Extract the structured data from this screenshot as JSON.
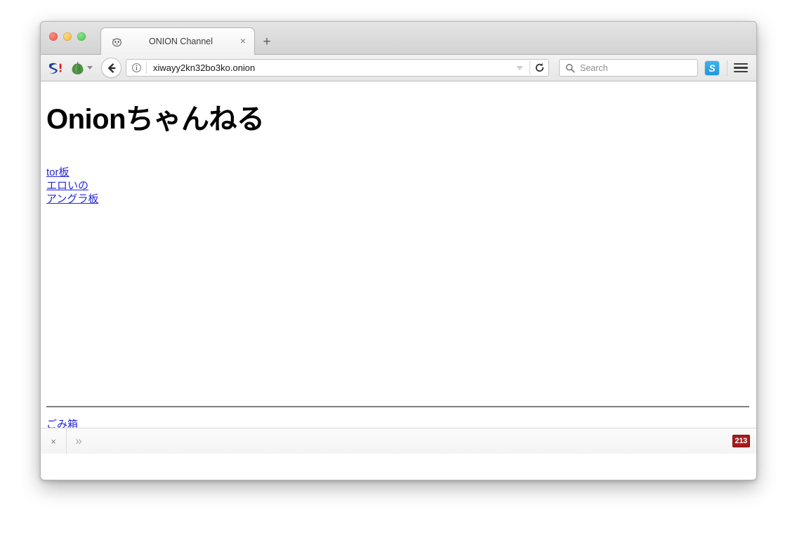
{
  "window": {
    "traffic_lights": [
      "close",
      "minimize",
      "zoom"
    ]
  },
  "tabstrip": {
    "tab_title": "ONION Channel",
    "tab_favicon": "cat-face-icon",
    "tab_close_glyph": "×",
    "new_tab_glyph": "+"
  },
  "toolbar": {
    "sharp_logo": "S!",
    "onion_button": "onion-icon",
    "back_glyph": "←",
    "identity_icon": "info-circle-icon",
    "url": "xiwayy2kn32bo3ko.onion",
    "url_dropdown": "chevron-down-icon",
    "reload_glyph": "⟳",
    "search_placeholder": "Search",
    "search_value": "",
    "skype_badge": "S",
    "menu_glyph": "hamburger-icon"
  },
  "page": {
    "heading": "Onionちゃんねる",
    "links": [
      {
        "label": "tor板"
      },
      {
        "label": "エロいの"
      },
      {
        "label": "アングラ板"
      }
    ],
    "footer_link": "ごみ箱"
  },
  "findbar": {
    "close_glyph": "×",
    "next_glyph": "»",
    "count": "213"
  },
  "colors": {
    "link": "#2727d8",
    "badge_bg": "#a81c1c",
    "skype_blue": "#1f96dc",
    "page_bg": "#ffffff"
  }
}
